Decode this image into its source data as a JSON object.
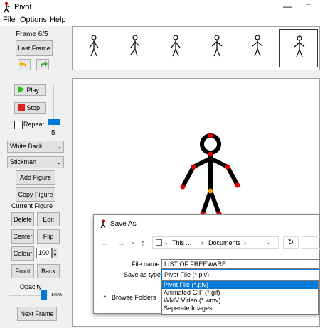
{
  "window": {
    "title": "Pivot",
    "controls": [
      "—",
      "□"
    ]
  },
  "menu": [
    "File",
    "Options",
    "Help"
  ],
  "left": {
    "frame_label": "Frame 6/5",
    "last_frame": "Last Frame",
    "play": "Play",
    "stop": "Stop",
    "repeat": "Repeat",
    "speed_value": "5",
    "background_select": "White Back",
    "figure_select": "Stickman",
    "add_figure": "Add Figure",
    "copy_figure": "Copy Figure",
    "current_figure": "Current Figure",
    "delete": "Delete",
    "edit": "Edit",
    "center": "Center",
    "flip": "Flip",
    "colour": "Colour",
    "colour_value": "100",
    "front": "Front",
    "back": "Back",
    "opacity": "Opacity",
    "opacity_value": "100%",
    "next_frame": "Next Frame"
  },
  "dialog": {
    "title": "Save As",
    "path": [
      "This ...",
      "Documents"
    ],
    "file_name_label": "File name:",
    "file_name_value": "LIST OF FREEWARE",
    "save_type_label": "Save as type:",
    "save_type_value": "Pivot File (*.piv)",
    "browse_folders": "Browse Folders",
    "options": [
      "Pivot File (*.piv)",
      "Animated GIF (*.gif)",
      "WMV Video (*.wmv)",
      "Seperate Images"
    ],
    "selected_option": 0
  },
  "colors": {
    "joint": "#e00000",
    "hip": "#f0a000",
    "accent": "#0078d7",
    "play_green": "#22c022",
    "stop_red": "#e02020"
  }
}
